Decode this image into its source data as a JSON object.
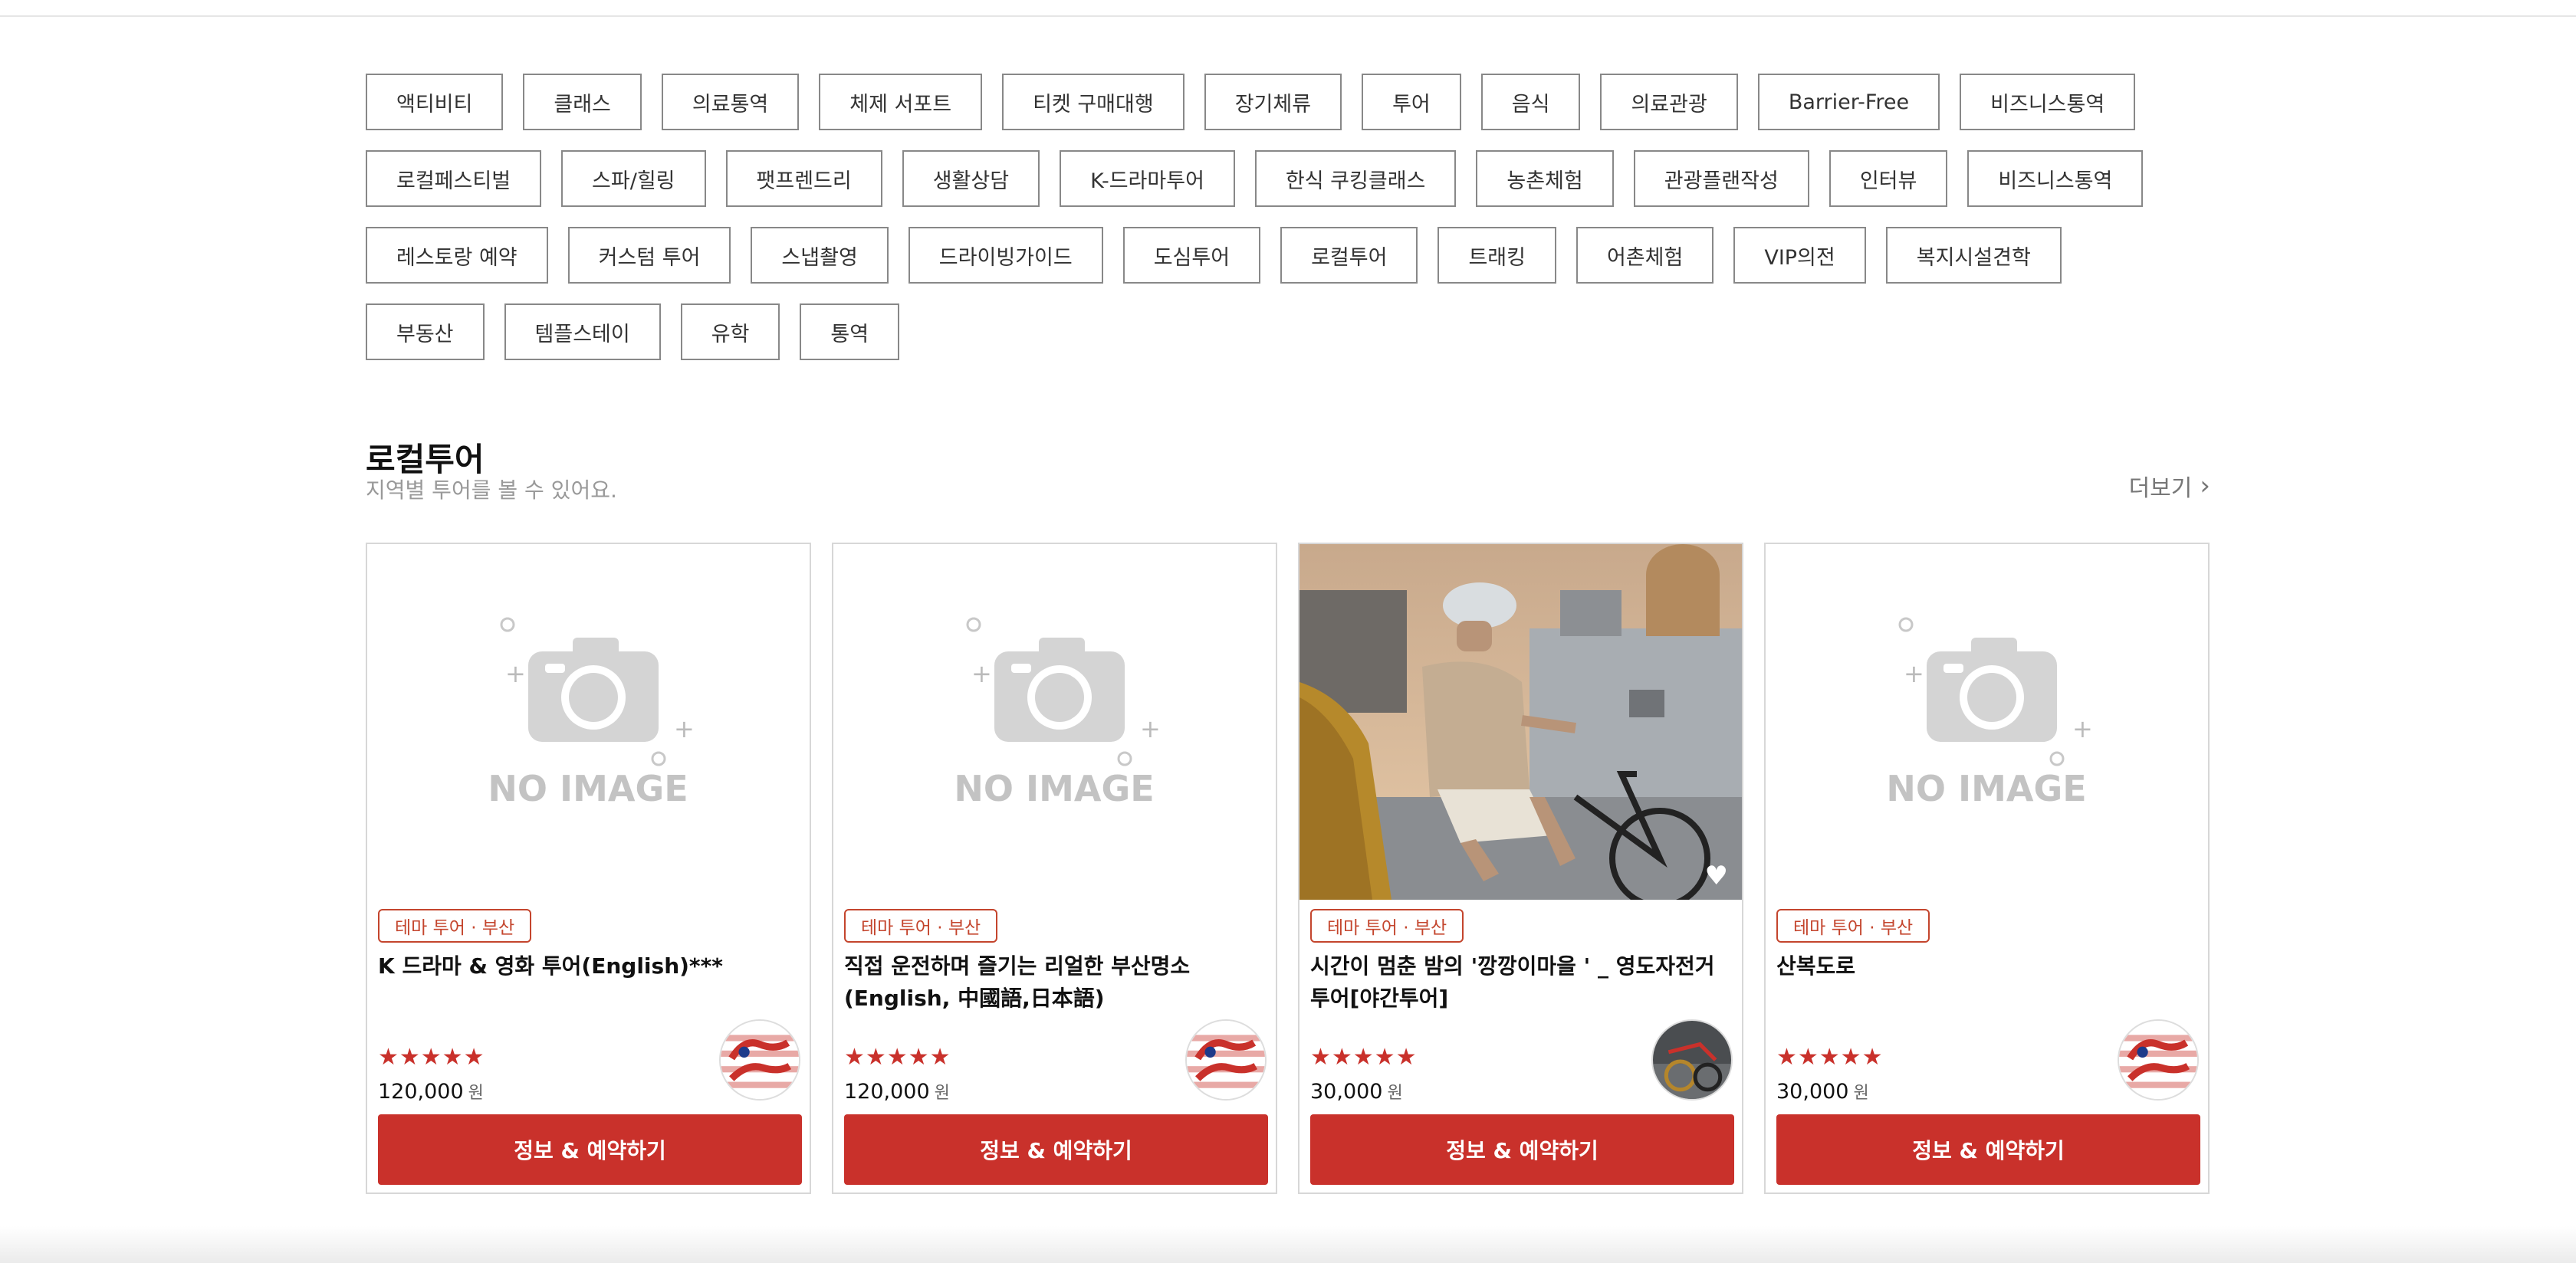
{
  "categories": [
    [
      "액티비티",
      "클래스",
      "의료통역",
      "체제 서포트",
      "티켓 구매대행",
      "장기체류",
      "투어",
      "음식",
      "의료관광",
      "Barrier-Free",
      "비즈니스통역"
    ],
    [
      "로컬페스티벌",
      "스파/힐링",
      "팻프렌드리",
      "생활상담",
      "K-드라마투어",
      "한식 쿠킹클래스",
      "농촌체험",
      "관광플랜작성",
      "인터뷰",
      "비즈니스통역"
    ],
    [
      "레스토랑 예약",
      "커스텀 투어",
      "스냅촬영",
      "드라이빙가이드",
      "도심투어",
      "로컬투어",
      "트래킹",
      "어촌체험",
      "VIP의전",
      "복지시설견학"
    ],
    [
      "부동산",
      "템플스테이",
      "유학",
      "통역"
    ]
  ],
  "section": {
    "title": "로컬투어",
    "subtitle": "지역별 투어를 볼 수 있어요.",
    "more": "더보기"
  },
  "cards": [
    {
      "image": "no-image",
      "tag": "테마 투어 · 부산",
      "title": "K 드라마 & 영화 투어(English)***",
      "stars": "★★★★★",
      "price": "120,000",
      "currency": "원",
      "badge": "korea-guide-logo",
      "button": "정보 & 예약하기",
      "noimage_text": "NO IMAGE"
    },
    {
      "image": "no-image",
      "tag": "테마 투어 · 부산",
      "title": "직접 운전하며 즐기는 리얼한 부산명소(English, 中國語,日本語)",
      "stars": "★★★★★",
      "price": "120,000",
      "currency": "원",
      "badge": "korea-guide-logo",
      "button": "정보 & 예약하기",
      "noimage_text": "NO IMAGE"
    },
    {
      "image": "photo-cyclist",
      "tag": "테마 투어 · 부산",
      "title": "시간이 멈춘 밤의 '깡깡이마을 ' _ 영도자전거투어[야간투어]",
      "stars": "★★★★★",
      "price": "30,000",
      "currency": "원",
      "badge": "guide-avatar",
      "button": "정보 & 예약하기"
    },
    {
      "image": "no-image",
      "tag": "테마 투어 · 부산",
      "title": "산복도로",
      "stars": "★★★★★",
      "price": "30,000",
      "currency": "원",
      "badge": "korea-guide-logo",
      "button": "정보 & 예약하기",
      "noimage_text": "NO IMAGE"
    }
  ],
  "colors": {
    "accent": "#c9312b",
    "tag": "#c4452d",
    "border": "#888888"
  }
}
